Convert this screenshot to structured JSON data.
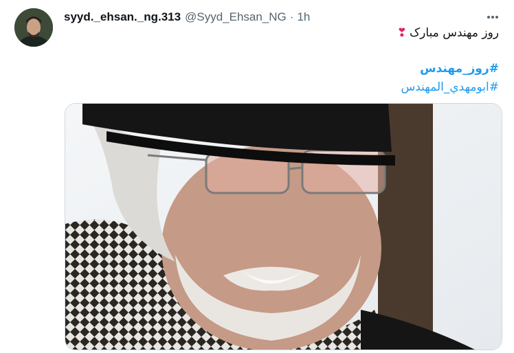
{
  "tweet": {
    "display_name": "syyd._ehsan._ng.313",
    "handle": "@Syyd_Ehsan_NG",
    "separator": "·",
    "time": "1h",
    "text_line1": "روز مهندس مبارک",
    "text_line1_emoji": "❣",
    "hashtag1": "#روز_مهندس",
    "hashtag2": "#ابومهدي_المهندس",
    "more_icon": "more-horizontal-icon"
  },
  "colors": {
    "accent": "#1d9bf0",
    "secondary_text": "#536471",
    "heart": "#e0245e",
    "border": "#cfd9de"
  }
}
